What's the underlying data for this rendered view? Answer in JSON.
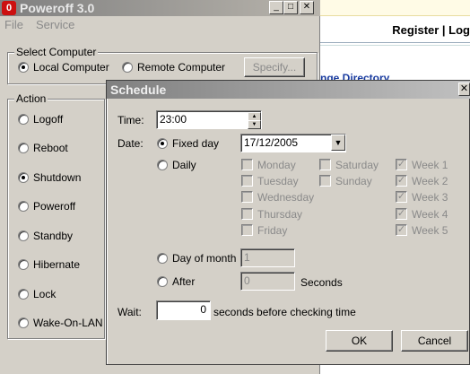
{
  "background_page": {
    "nav_text": "Register | Log",
    "link_text": "nge Directory"
  },
  "main_window": {
    "title": "Poweroff 3.0",
    "app_icon_glyph": "0",
    "controls": {
      "minimize": "_",
      "maximize": "□",
      "close": "✕"
    },
    "menu": [
      "File",
      "Service"
    ],
    "select_computer": {
      "label": "Select Computer",
      "local": "Local Computer",
      "remote": "Remote Computer",
      "specify_button": "Specify...",
      "selected": "local"
    },
    "action": {
      "label": "Action",
      "items": [
        "Logoff",
        "Reboot",
        "Shutdown",
        "Poweroff",
        "Standby",
        "Hibernate",
        "Lock",
        "Wake-On-LAN"
      ],
      "selected": "Shutdown"
    }
  },
  "schedule": {
    "title": "Schedule",
    "close_glyph": "✕",
    "time_label": "Time:",
    "time_value": "23:00",
    "date_label": "Date:",
    "fixed_day_label": "Fixed day",
    "fixed_day_value": "17/12/2005",
    "daily_label": "Daily",
    "days_col1": [
      "Monday",
      "Tuesday",
      "Wednesday",
      "Thursday",
      "Friday"
    ],
    "days_col2": [
      "Saturday",
      "Sunday"
    ],
    "weeks": [
      "Week 1",
      "Week 2",
      "Week 3",
      "Week 4",
      "Week 5"
    ],
    "weeks_checked": true,
    "day_of_month_label": "Day of month",
    "day_of_month_value": "1",
    "after_label": "After",
    "after_value": "0",
    "seconds_label": "Seconds",
    "wait_label": "Wait:",
    "wait_value": "0",
    "wait_suffix": "seconds before checking time",
    "ok_button": "OK",
    "cancel_button": "Cancel",
    "selected_date_mode": "fixed"
  }
}
